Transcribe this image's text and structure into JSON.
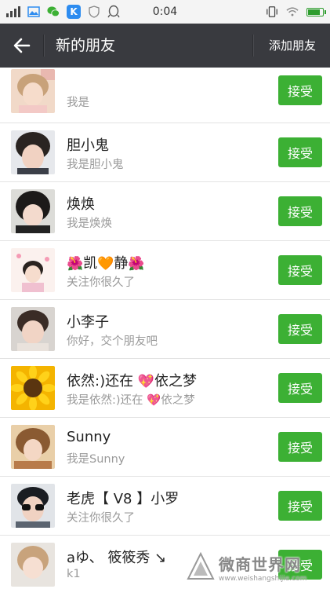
{
  "status_bar": {
    "time": "0:04",
    "icons": [
      "signal-icon",
      "image-icon",
      "wechat-icon",
      "k-app-icon",
      "shield-icon",
      "qq-icon",
      "vibrate-icon",
      "wifi-icon",
      "battery-icon"
    ],
    "k_label": "K",
    "battery_level": 0.85
  },
  "nav": {
    "title": "新的朋友",
    "add_friend_label": "添加朋友"
  },
  "friends": [
    {
      "name": "",
      "message": "我是",
      "button": "接受"
    },
    {
      "name": "胆小鬼",
      "message": "我是胆小鬼",
      "button": "接受"
    },
    {
      "name": "焕焕",
      "message": "我是焕焕",
      "button": "接受"
    },
    {
      "name_prefix": "🌺",
      "name_a": "凯",
      "name_mid": "🧡",
      "name_b": "静",
      "name_suffix": "🌺",
      "message": "关注你很久了",
      "button": "接受"
    },
    {
      "name": "小李子",
      "message": "你好，交个朋友吧",
      "button": "接受"
    },
    {
      "name_a": "依然:)还在 ",
      "name_mid": "💖",
      "name_b": "依之梦",
      "message_a": "我是依然:)还在 ",
      "message_mid": "💖",
      "message_b": "依之梦",
      "button": "接受"
    },
    {
      "name": "Sunny",
      "message": "我是Sunny",
      "button": "接受"
    },
    {
      "name": "老虎【 V8 】小罗",
      "message": "关注你很久了",
      "button": "接受"
    },
    {
      "name": "aゆ、 筱筱秀 ↘",
      "message": "k1",
      "button": "接受"
    }
  ],
  "watermark": {
    "big": "微商世界网",
    "small": "www.weishangshijie.com"
  },
  "colors": {
    "nav_bg": "#393a3f",
    "accept_green": "#3cb034",
    "status_bg": "#f4f4f4"
  }
}
